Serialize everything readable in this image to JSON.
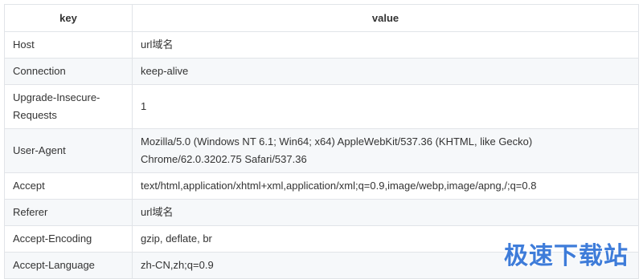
{
  "table": {
    "headers": {
      "key": "key",
      "value": "value"
    },
    "rows": [
      {
        "key": "Host",
        "value": "url域名"
      },
      {
        "key": "Connection",
        "value": "keep-alive"
      },
      {
        "key": "Upgrade-Insecure-Requests",
        "value": "1"
      },
      {
        "key": "User-Agent",
        "value": "Mozilla/5.0 (Windows NT 6.1; Win64; x64) AppleWebKit/537.36 (KHTML, like Gecko) Chrome/62.0.3202.75 Safari/537.36"
      },
      {
        "key": "Accept",
        "value": "text/html,application/xhtml+xml,application/xml;q=0.9,image/webp,image/apng,/;q=0.8"
      },
      {
        "key": "Referer",
        "value": "url域名"
      },
      {
        "key": "Accept-Encoding",
        "value": "gzip, deflate, br"
      },
      {
        "key": "Accept-Language",
        "value": "zh-CN,zh;q=0.9"
      }
    ]
  },
  "watermark": {
    "text": "极速下载站",
    "color": "#2b6fd6"
  }
}
